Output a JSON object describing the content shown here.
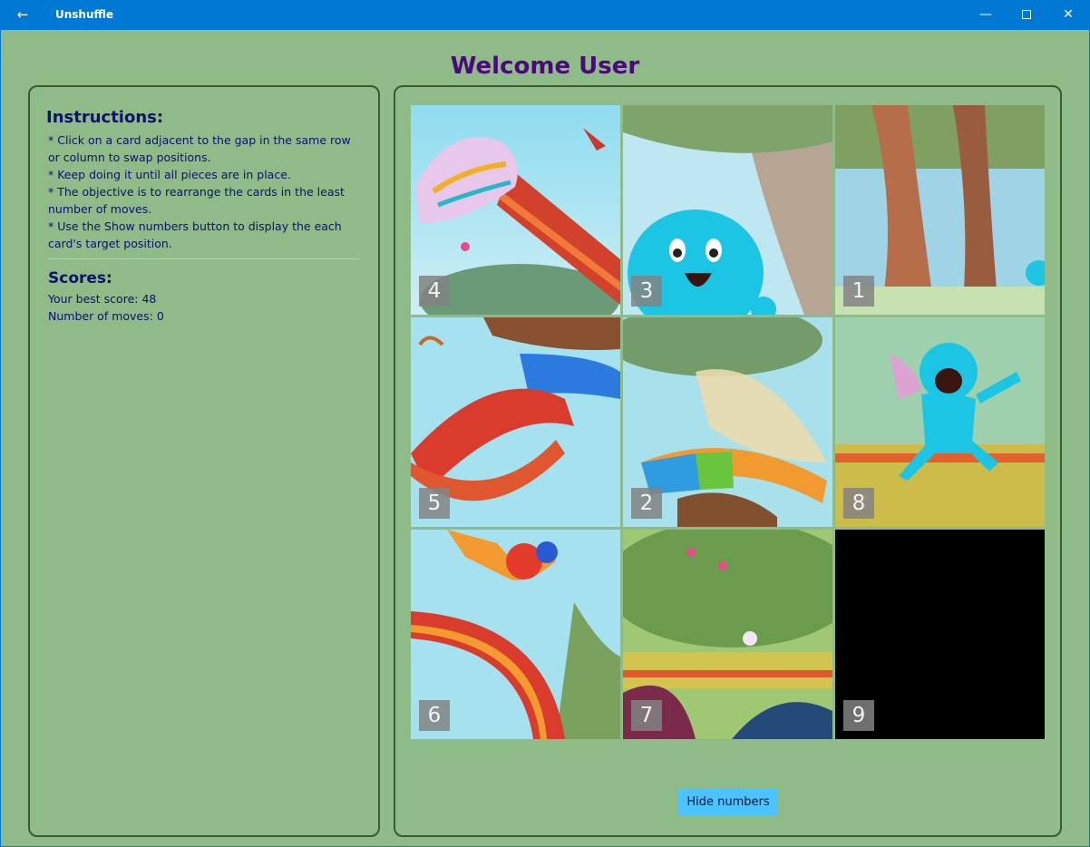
{
  "window": {
    "title": "Unshuffle",
    "back_icon": "←",
    "min_icon": "—",
    "close_icon": "✕",
    "accent": "#0078d4"
  },
  "header": {
    "welcome": "Welcome User"
  },
  "instructions": {
    "heading": "Instructions:",
    "items": [
      "* Click on a card adjacent to the gap in the same row or column to swap positions.",
      "* Keep doing it until all pieces are in place.",
      "* The objective is to rearrange the cards in the least number of moves.",
      "* Use the Show numbers button to display the each card's target position."
    ]
  },
  "scores": {
    "heading": "Scores:",
    "best_score": "Your best score: 48",
    "moves": "Number of moves: 0"
  },
  "board": {
    "tiles": [
      {
        "number": "4",
        "art": "sneaker-leg"
      },
      {
        "number": "3",
        "art": "blue-creature-face"
      },
      {
        "number": "1",
        "art": "forest-trees"
      },
      {
        "number": "5",
        "art": "leg-backpack"
      },
      {
        "number": "2",
        "art": "wing-arm"
      },
      {
        "number": "8",
        "art": "running-creature"
      },
      {
        "number": "6",
        "art": "rainbow-arms"
      },
      {
        "number": "7",
        "art": "grass-flowers"
      },
      {
        "number": "9",
        "art": "empty-gap"
      }
    ],
    "empty_color": "#000000"
  },
  "controls": {
    "hide_numbers_label": "Hide numbers"
  },
  "colors": {
    "background": "#8fbb88",
    "heading": "#4b0a7a",
    "text": "#10106e",
    "button": "#4cc2ff"
  }
}
